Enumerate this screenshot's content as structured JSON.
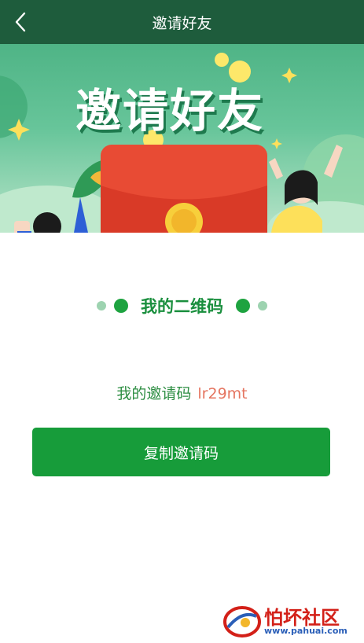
{
  "header": {
    "title": "邀请好友",
    "back_icon": "chevron-left-icon"
  },
  "banner": {
    "title": "邀请好友"
  },
  "qr_section": {
    "title": "我的二维码"
  },
  "invite": {
    "label": "我的邀请码",
    "code": "lr29mt"
  },
  "copy_button": {
    "label": "复制邀请码"
  },
  "watermark": {
    "text": "怕坏社区",
    "url": "www.pahuai.com"
  },
  "colors": {
    "header_bg": "#1e5c3c",
    "accent_green": "#179c3a",
    "code_color": "#e57560"
  }
}
